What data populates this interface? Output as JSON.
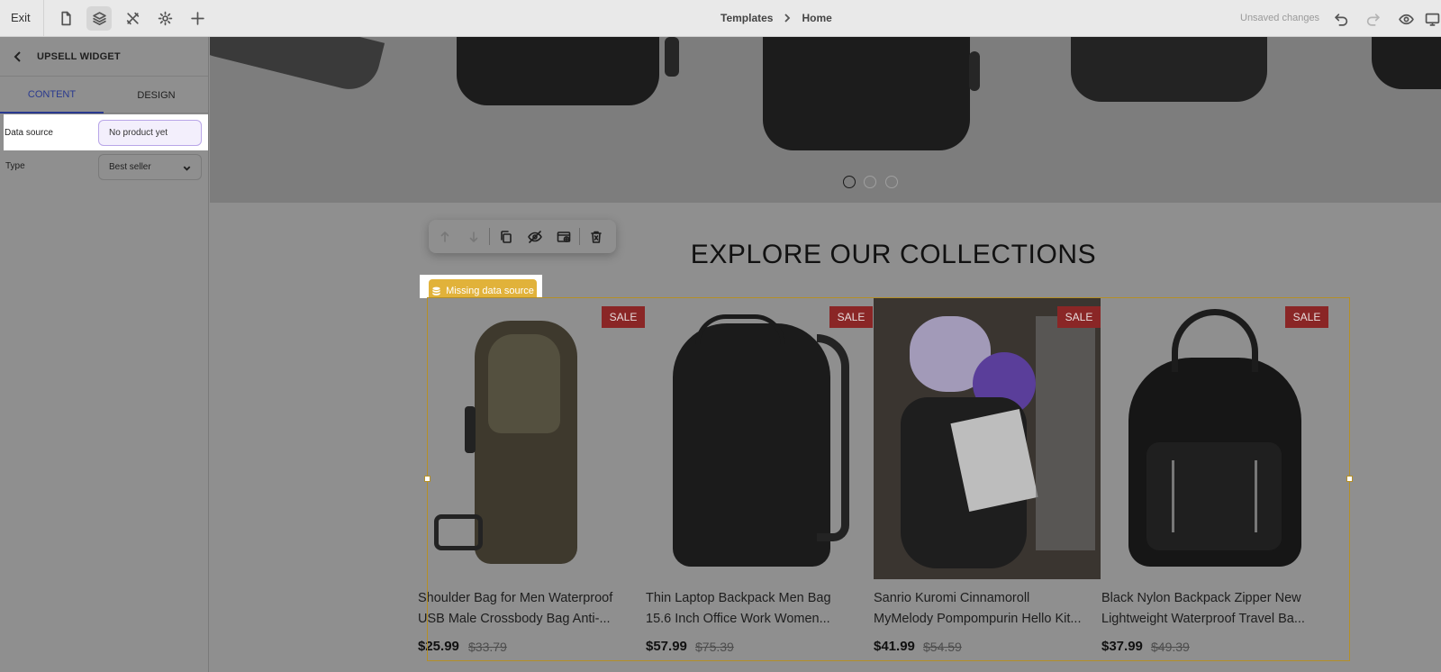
{
  "topbar": {
    "exit_label": "Exit",
    "breadcrumb": [
      "Templates",
      "Home"
    ],
    "status": "Unsaved changes"
  },
  "panel": {
    "title": "UPSELL WIDGET",
    "tabs": [
      "CONTENT",
      "DESIGN"
    ],
    "data_source": {
      "label": "Data source",
      "value": "No product yet"
    },
    "type": {
      "label": "Type",
      "value": "Best seller"
    }
  },
  "canvas": {
    "section_title": "EXPLORE OUR COLLECTIONS",
    "missing_badge": "Missing data source",
    "slider_dots": 3,
    "products": [
      {
        "title_line1": "Shoulder Bag for Men Waterproof",
        "title_line2": "USB Male Crossbody Bag Anti-...",
        "price": "$25.99",
        "old_price": "$33.79",
        "badge": "SALE"
      },
      {
        "title_line1": "Thin Laptop Backpack Men Bag",
        "title_line2": "15.6 Inch Office Work Women...",
        "price": "$57.99",
        "old_price": "$75.39",
        "badge": "SALE"
      },
      {
        "title_line1": "Sanrio Kuromi Cinnamoroll",
        "title_line2": "MyMelody Pompompurin Hello Kit...",
        "price": "$41.99",
        "old_price": "$54.59",
        "badge": "SALE"
      },
      {
        "title_line1": "Black Nylon Backpack Zipper New",
        "title_line2": "Lightweight Waterproof Travel Ba...",
        "price": "$37.99",
        "old_price": "$49.39",
        "badge": "SALE"
      }
    ]
  },
  "colors": {
    "overlay": "#8f8f8f",
    "accent": "#2a3a8f",
    "warning": "#e1b23a",
    "frame": "#b48f27",
    "sale_badge": "#8a2626"
  },
  "icons": [
    "document-icon",
    "layers-icon",
    "tools-icon",
    "gear-icon",
    "plus-icon",
    "chevron-right-icon",
    "undo-icon",
    "redo-icon",
    "eye-icon",
    "monitor-icon",
    "chevron-left-icon",
    "chevron-down-icon",
    "arrow-up-icon",
    "arrow-down-icon",
    "duplicate-icon",
    "eye-off-icon",
    "add-section-icon",
    "delete-icon",
    "database-icon"
  ]
}
